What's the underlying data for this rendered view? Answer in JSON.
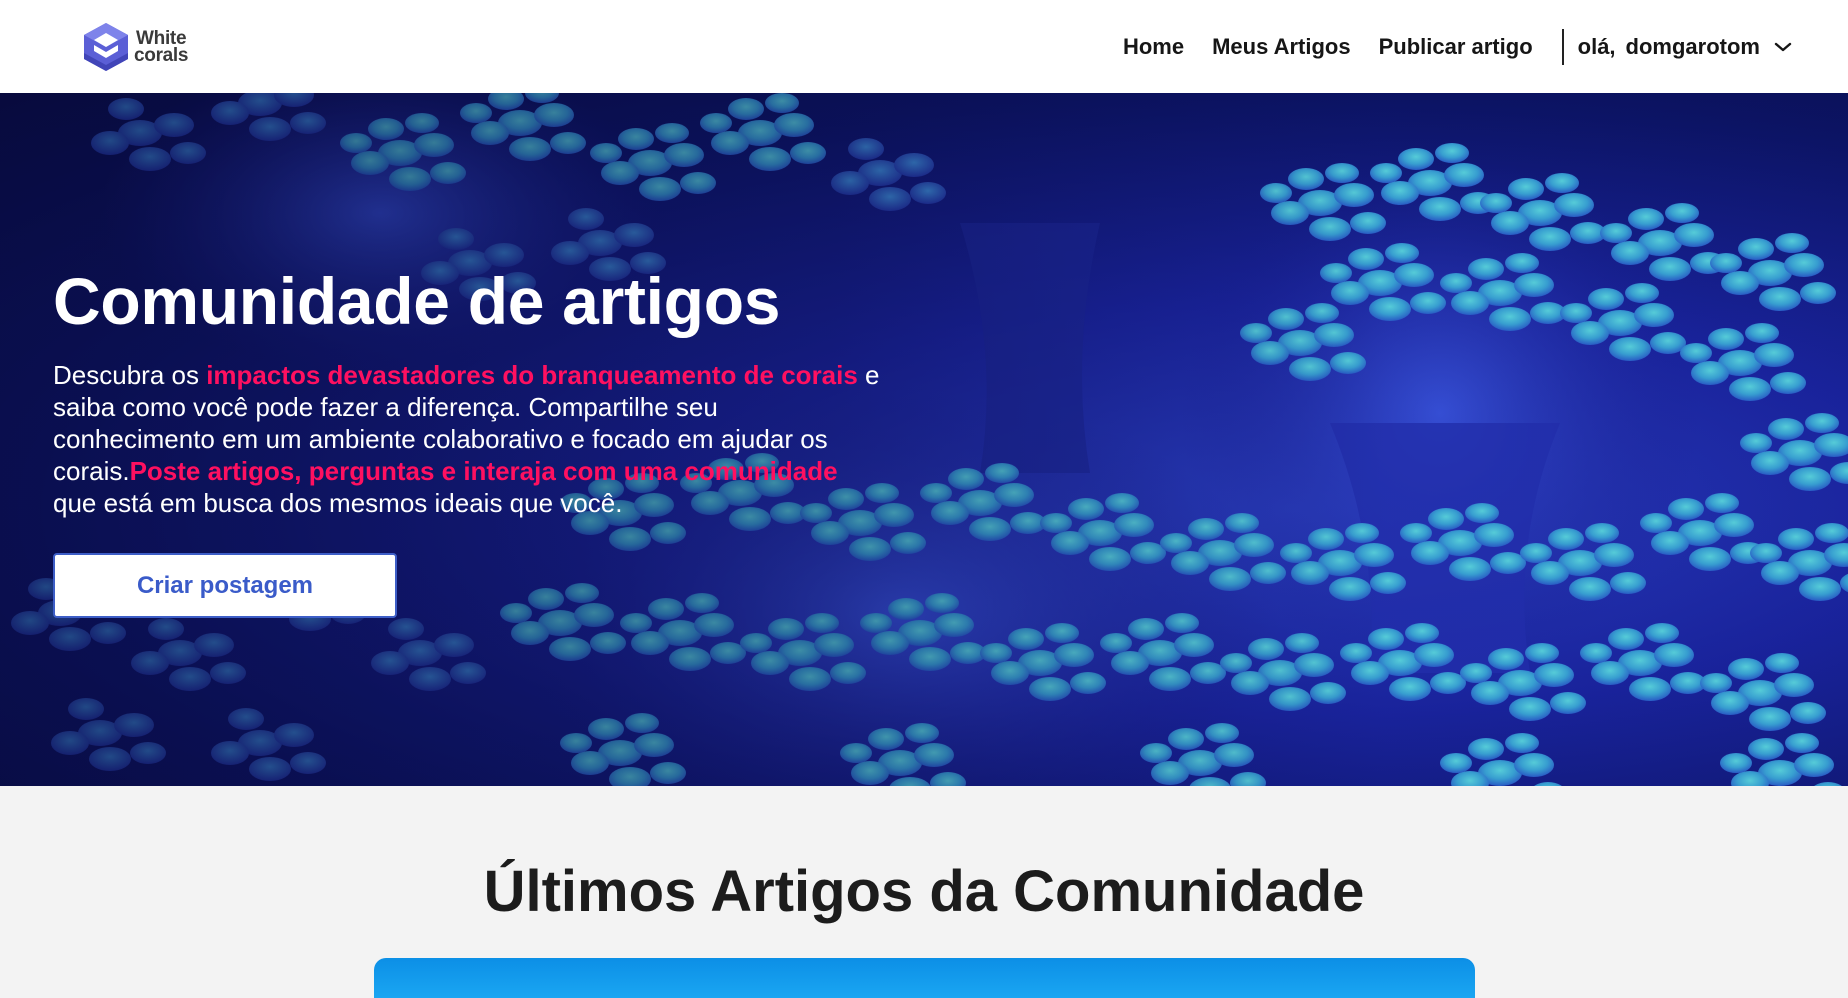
{
  "header": {
    "logo": {
      "line1": "White",
      "line2": "corals",
      "icon": "hexagon-cube-logo"
    },
    "nav": [
      {
        "label": "Home"
      },
      {
        "label": "Meus Artigos"
      },
      {
        "label": "Publicar artigo"
      }
    ],
    "user": {
      "greeting": "olá,",
      "name": "domgarotom",
      "icon": "chevron-down-icon"
    }
  },
  "hero": {
    "title": "Comunidade de artigos",
    "desc": {
      "p1": "Descubra os ",
      "h1": "impactos devastadores do branqueamento de corais",
      "p2": " e saiba como você pode fazer a diferença. Compartilhe seu conhecimento em um ambiente colaborativo e focado em ajudar os corais.",
      "h2": "Poste artigos, perguntas e interaja com uma comunidade",
      "p3": " que está em busca dos mesmos ideais que você."
    },
    "cta_label": "Criar postagem",
    "highlight_color": "#ff1060"
  },
  "latest": {
    "title": "Últimos Artigos da Comunidade"
  }
}
